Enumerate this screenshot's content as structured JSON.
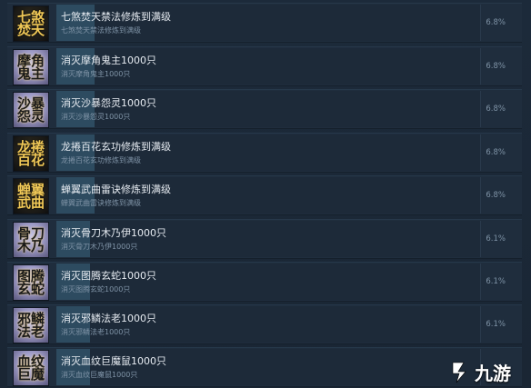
{
  "achievements": [
    {
      "title": "七煞焚天禁法修炼到满级",
      "desc": "七煞焚天禁法修炼到满级",
      "percent": "6.8%",
      "fill": 0.068,
      "icon": "gold-seal-icon",
      "icon_text": "七煞焚天"
    },
    {
      "title": "消灭摩角鬼主1000只",
      "desc": "消灭摩角鬼主1000只",
      "percent": "6.8%",
      "fill": 0.068,
      "icon": "purple-demon-icon",
      "icon_text": "摩角鬼主"
    },
    {
      "title": "消灭沙暴怨灵1000只",
      "desc": "消灭沙暴怨灵1000只",
      "percent": "6.8%",
      "fill": 0.068,
      "icon": "purple-demon-icon",
      "icon_text": "沙暴怨灵"
    },
    {
      "title": "龙捲百花玄功修炼到满级",
      "desc": "龙捲百花玄功修炼到满级",
      "percent": "6.8%",
      "fill": 0.068,
      "icon": "gold-seal-icon",
      "icon_text": "龙捲百花"
    },
    {
      "title": "蝉翼武曲雷诀修炼到满级",
      "desc": "蝉翼武曲雷诀修炼到满级",
      "percent": "6.8%",
      "fill": 0.068,
      "icon": "gold-seal-icon",
      "icon_text": "蝉翼武曲"
    },
    {
      "title": "消灭骨刀木乃伊1000只",
      "desc": "消灭骨刀木乃伊1000只",
      "percent": "6.1%",
      "fill": 0.061,
      "icon": "purple-demon-icon",
      "icon_text": "骨刀木乃"
    },
    {
      "title": "消灭图腾玄蛇1000只",
      "desc": "消灭图腾玄蛇1000只",
      "percent": "6.1%",
      "fill": 0.061,
      "icon": "purple-demon-icon",
      "icon_text": "图腾玄蛇"
    },
    {
      "title": "消灭邪鳞法老1000只",
      "desc": "消灭邪鳞法老1000只",
      "percent": "6.1%",
      "fill": 0.061,
      "icon": "purple-demon-icon",
      "icon_text": "邪鳞法老"
    },
    {
      "title": "消灭血纹巨魔鼠1000只",
      "desc": "消灭血纹巨魔鼠1000只",
      "percent": "",
      "fill": 0.061,
      "icon": "purple-demon-icon",
      "icon_text": "血纹巨魔"
    }
  ],
  "watermark": {
    "text": "九游",
    "icon": "jiuyou-logo-icon"
  },
  "colors": {
    "bar_fill": "#2d4b60",
    "title": "#e6ebf1",
    "desc": "#7f93a6"
  }
}
